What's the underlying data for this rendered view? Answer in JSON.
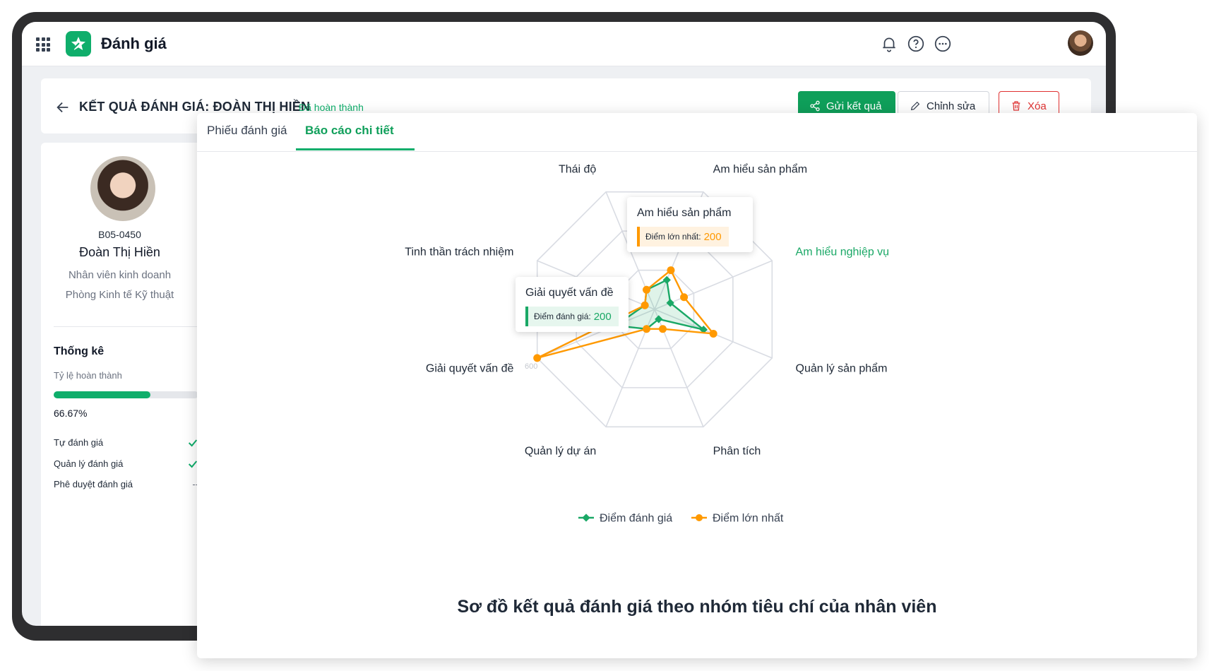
{
  "app": {
    "title": "Đánh giá"
  },
  "header": {
    "title": "KẾT QUẢ ĐÁNH GIÁ: ĐOÀN THỊ HIỀN",
    "status": "Đã hoàn thành",
    "send_label": "Gửi kết quả",
    "edit_label": "Chỉnh sửa",
    "delete_label": "Xóa"
  },
  "profile": {
    "code": "B05-0450",
    "name": "Đoàn Thị Hiền",
    "role": "Nhân viên kinh doanh",
    "department": "Phòng Kinh tế Kỹ thuật"
  },
  "stats": {
    "title": "Thống kê",
    "completion_label": "Tỷ lệ hoàn thành",
    "completion_value": "66.67%",
    "completion_fraction": 0.6667,
    "steps": [
      {
        "label": "Tự đánh giá",
        "status": "done"
      },
      {
        "label": "Quản lý đánh giá",
        "status": "done"
      },
      {
        "label": "Phê duyệt đánh giá",
        "status": "--"
      }
    ]
  },
  "tabs": [
    {
      "label": "Phiếu đánh giá",
      "active": false
    },
    {
      "label": "Báo cáo chi tiết",
      "active": true
    }
  ],
  "chart_data": {
    "type": "radar",
    "categories": [
      "Thái độ",
      "Am hiểu sản phẩm",
      "Am hiểu nghiệp vụ",
      "Quản lý sản phẩm",
      "Phân tích",
      "Quản lý dự án",
      "Giải quyết vấn đề",
      "Tinh thần trách nhiệm"
    ],
    "highlighted_category": "Am hiểu nghiệp vụ",
    "series": [
      {
        "name": "Điểm đánh giá",
        "color": "#1aa866",
        "values": [
          100,
          150,
          80,
          250,
          50,
          100,
          200,
          50
        ]
      },
      {
        "name": "Điểm lớn nhất",
        "color": "#ff9900",
        "values": [
          100,
          200,
          150,
          300,
          100,
          100,
          600,
          50
        ]
      }
    ],
    "max": 600,
    "axis_label": "600",
    "tooltips": [
      {
        "title": "Am hiểu sản phẩm",
        "series": "Điểm lớn nhất",
        "label": "Điểm lớn nhất:",
        "value": "200",
        "color": "#ff9900"
      },
      {
        "title": "Giải quyết vấn đề",
        "series": "Điểm đánh giá",
        "label": "Điểm đánh giá:",
        "value": "200",
        "color": "#1aa866"
      }
    ],
    "caption": "Sơ đồ kết quả đánh giá theo nhóm tiêu chí của nhân viên"
  }
}
